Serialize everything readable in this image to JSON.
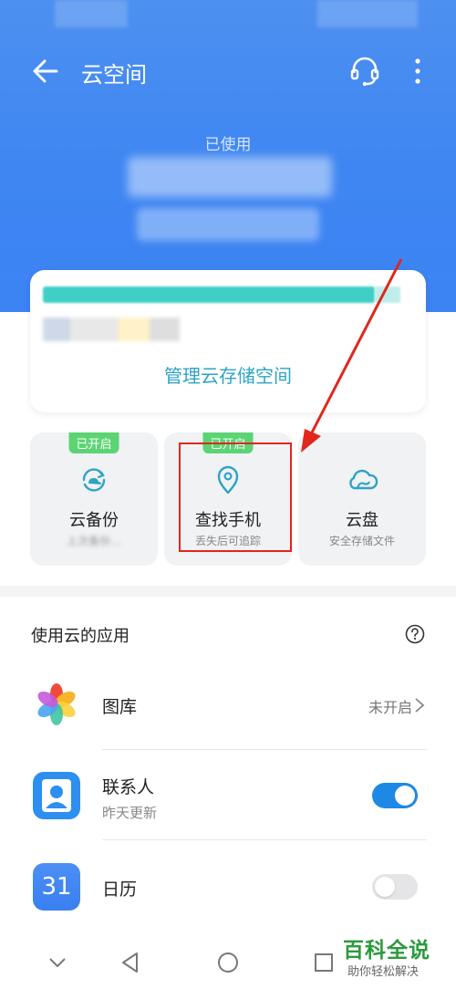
{
  "header": {
    "title": "云空间",
    "used_label": "已使用"
  },
  "storage": {
    "manage_label": "管理云存储空间"
  },
  "tiles": [
    {
      "label": "云备份",
      "subtitle": "上次备份…",
      "badge": "已开启"
    },
    {
      "label": "查找手机",
      "subtitle": "丢失后可追踪",
      "badge": "已开启"
    },
    {
      "label": "云盘",
      "subtitle": "安全存储文件",
      "badge": ""
    }
  ],
  "apps_section": {
    "title": "使用云的应用",
    "items": [
      {
        "name": "图库",
        "subtitle": "",
        "status": "未开启"
      },
      {
        "name": "联系人",
        "subtitle": "昨天更新",
        "toggle_on": true
      },
      {
        "name": "日历",
        "subtitle": "",
        "toggle_on": false,
        "icon_text": "31"
      }
    ]
  },
  "watermark": {
    "title": "百科全说",
    "subtitle": "助你轻松解决"
  },
  "colors": {
    "header_blue": "#3f86f2",
    "accent_teal": "#2ea3c6",
    "toggle_on": "#1e88e5",
    "badge_green": "#5cd474",
    "annotation_red": "#e0261d"
  }
}
